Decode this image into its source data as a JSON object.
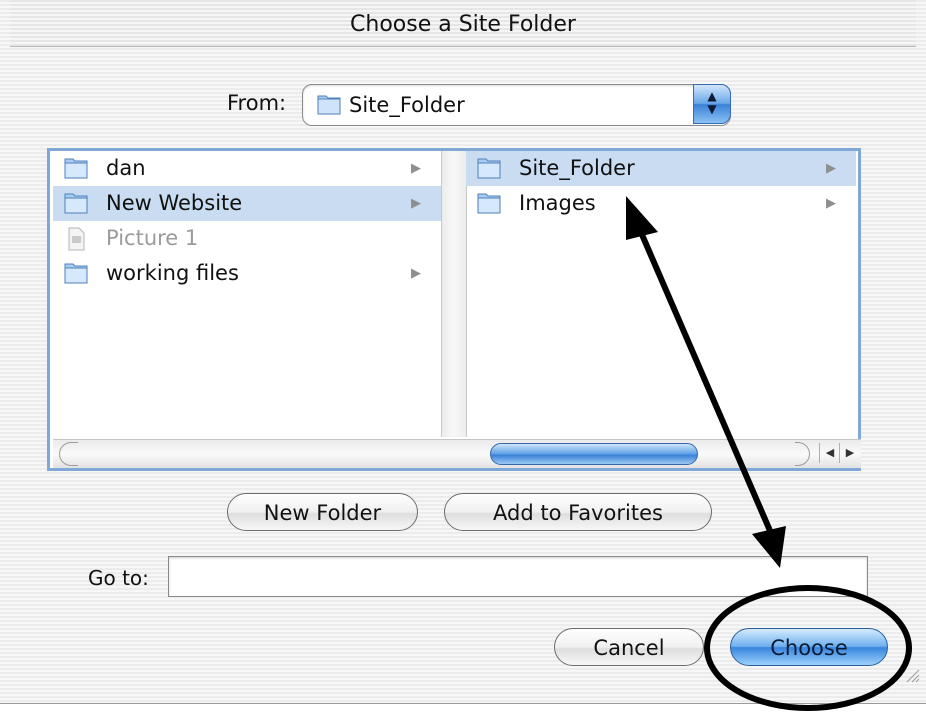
{
  "dialog": {
    "title": "Choose a Site Folder"
  },
  "from": {
    "label": "From:",
    "selected": "Site_Folder"
  },
  "browser": {
    "column1": [
      {
        "name": "dan",
        "type": "folder",
        "selected": false,
        "has_children": true
      },
      {
        "name": "New Website",
        "type": "folder",
        "selected": true,
        "has_children": true
      },
      {
        "name": "Picture 1",
        "type": "file",
        "selected": false,
        "has_children": false
      },
      {
        "name": "working files",
        "type": "folder",
        "selected": false,
        "has_children": true
      }
    ],
    "column2": [
      {
        "name": "Site_Folder",
        "type": "folder",
        "selected": true,
        "has_children": true
      },
      {
        "name": "Images",
        "type": "folder",
        "selected": false,
        "has_children": true
      }
    ]
  },
  "buttons": {
    "new_folder": "New Folder",
    "add_to_favorites": "Add to Favorites",
    "cancel": "Cancel",
    "choose": "Choose"
  },
  "goto": {
    "label": "Go to:",
    "value": ""
  },
  "colors": {
    "selection": "#c9dcf2",
    "accent": "#3785de",
    "annotation": "#000000"
  },
  "annotation": {
    "type": "double-arrow-and-circle",
    "target": "choose-button"
  }
}
